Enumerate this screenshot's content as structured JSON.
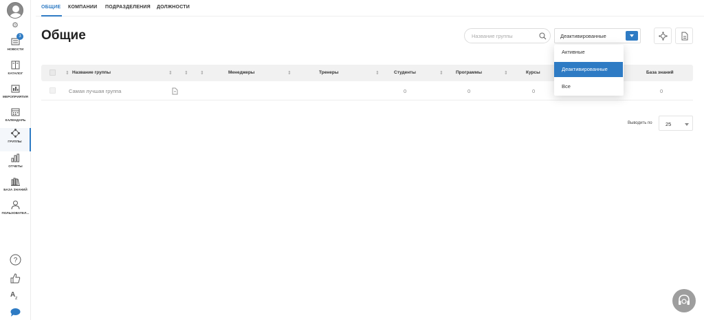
{
  "sidebar": {
    "news_badge": "3",
    "items": [
      {
        "label": "НОВОСТИ",
        "icon": "news-icon"
      },
      {
        "label": "КАТАЛОГ",
        "icon": "catalog-icon"
      },
      {
        "label": "МЕРОПРИЯТИЯ",
        "icon": "events-icon"
      },
      {
        "label": "КАЛЕНДАРЬ",
        "icon": "calendar-icon"
      },
      {
        "label": "ГРУППЫ",
        "icon": "groups-icon"
      },
      {
        "label": "ОТЧЕТЫ",
        "icon": "reports-icon"
      },
      {
        "label": "БАЗА ЗНАНИЙ",
        "icon": "knowledge-base-icon"
      },
      {
        "label": "ПОЛЬЗОВАТЕЛ...",
        "icon": "users-icon"
      }
    ],
    "active_index": 4
  },
  "tabs": [
    "ОБЩИЕ",
    "КОМПАНИИ",
    "ПОДРАЗДЕЛЕНИЯ",
    "ДОЛЖНОСТИ"
  ],
  "page_title": "Общие",
  "search": {
    "placeholder": "Название группы"
  },
  "filter": {
    "selected": "Деактивированные",
    "options": [
      "Активные",
      "Деактивированные",
      "Все"
    ]
  },
  "table": {
    "headers": {
      "name": "Название группы",
      "managers": "Менеджеры",
      "trainers": "Тренеры",
      "students": "Студенты",
      "programs": "Программы",
      "courses": "Курсы",
      "knowledge": "База знаний"
    },
    "rows": [
      {
        "name": "Самая лучшая группа",
        "students": "0",
        "programs": "0",
        "courses": "0",
        "knowledge": "0"
      }
    ]
  },
  "pagination": {
    "label": "Выводить по",
    "value": "25"
  },
  "colors": {
    "accent": "#2e7bc4"
  }
}
